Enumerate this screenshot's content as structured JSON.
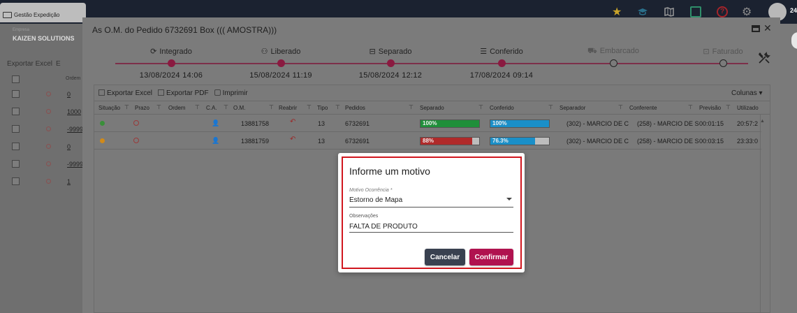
{
  "app": {
    "tab_label": "Gestão Expedição",
    "company_label": "Empresa",
    "company_name": "KAIZEN SOLUTIONS",
    "user_short": "24",
    "toolbar_export_excel": "Exportar Excel",
    "toolbar_extra": "E",
    "bg_column_ordem": "Ordem",
    "bg_rows": [
      "0",
      "1000",
      "-9999",
      "0",
      "-9999",
      "1"
    ]
  },
  "modal": {
    "title": "As O.M. do Pedido 6732691 Box ((( AMOSTRA)))",
    "steps": [
      {
        "label": "Integrado",
        "date": "13/08/2024 14:06",
        "done": true,
        "icon": "sync-icon"
      },
      {
        "label": "Liberado",
        "date": "15/08/2024 11:19",
        "done": true,
        "icon": "user-check-icon"
      },
      {
        "label": "Separado",
        "date": "15/08/2024 12:12",
        "done": true,
        "icon": "pallet-icon"
      },
      {
        "label": "Conferido",
        "date": "17/08/2024 09:14",
        "done": true,
        "icon": "checklist-icon"
      },
      {
        "label": "Embarcado",
        "date": "",
        "done": false,
        "icon": "truck-icon"
      },
      {
        "label": "Faturado",
        "date": "",
        "done": false,
        "icon": "money-icon"
      }
    ],
    "toolbar": {
      "export_excel": "Exportar Excel",
      "export_pdf": "Exportar PDF",
      "print": "Imprimir",
      "columns": "Colunas"
    },
    "columns": [
      "Situação",
      "Prazo",
      "Ordem",
      "C.A.",
      "O.M.",
      "Reabrir",
      "Tipo",
      "Pedidos",
      "Separado",
      "Conferido",
      "Separador",
      "Conferente",
      "Previsão",
      "Utilizado"
    ],
    "rows": [
      {
        "situacao_color": "#3a8f3a",
        "om": "13881758",
        "tipo": "13",
        "pedido": "6732691",
        "separado_pct": 100,
        "separado_label": "100%",
        "separado_color": "#1f8f3a",
        "conferido_pct": 100,
        "conferido_label": "100%",
        "conferido_color": "#1a8fc8",
        "separador": "(302) - MARCIO DE C",
        "conferente": "(258) - MARCIO DE S",
        "previsao": "00:01:15",
        "utilizado": "20:57:2"
      },
      {
        "situacao_color": "#d08a1a",
        "om": "13881759",
        "tipo": "13",
        "pedido": "6732691",
        "separado_pct": 88,
        "separado_label": "88%",
        "separado_color": "#b02a2a",
        "conferido_pct": 76.3,
        "conferido_label": "76.3%",
        "conferido_color": "#1a8fc8",
        "separador": "(302) - MARCIO DE C",
        "conferente": "(258) - MARCIO DE S",
        "previsao": "00:03:15",
        "utilizado": "23:33:0"
      }
    ]
  },
  "dialog": {
    "title": "Informe um motivo",
    "motivo_label": "Motivo Ocorrência *",
    "motivo_value": "Estorno de Mapa",
    "obs_label": "Observações",
    "obs_value": "FALTA DE PRODUTO",
    "cancel_label": "Cancelar",
    "confirm_label": "Confirmar",
    "highlight_color": "#d0161e"
  }
}
